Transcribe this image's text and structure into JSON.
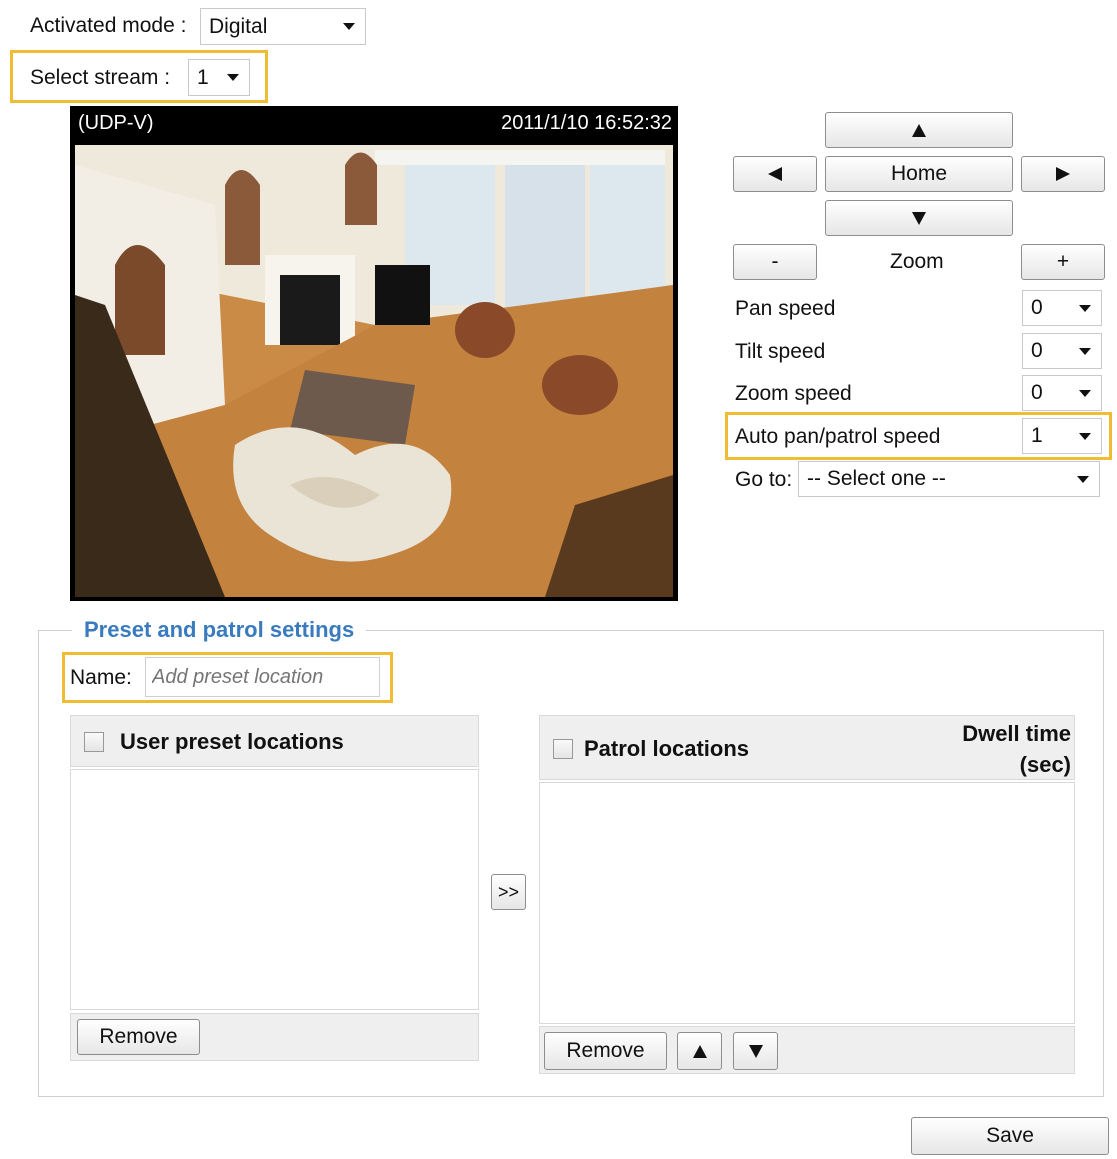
{
  "activated_mode": {
    "label": "Activated mode :",
    "value": "Digital"
  },
  "select_stream": {
    "label": "Select stream :",
    "value": "1"
  },
  "video": {
    "protocol": "(UDP-V)",
    "timestamp": "2011/1/10 16:52:32"
  },
  "ptz": {
    "home_label": "Home",
    "zoom_label": "Zoom",
    "zoom_out_label": "-",
    "zoom_in_label": "+",
    "pan_speed": {
      "label": "Pan speed",
      "value": "0"
    },
    "tilt_speed": {
      "label": "Tilt speed",
      "value": "0"
    },
    "zoom_speed": {
      "label": "Zoom speed",
      "value": "0"
    },
    "auto_pan_speed": {
      "label": "Auto pan/patrol speed",
      "value": "1"
    },
    "goto": {
      "label": "Go to:",
      "value": "-- Select one --"
    }
  },
  "preset": {
    "legend": "Preset and patrol settings",
    "name_label": "Name:",
    "name_placeholder": "Add preset location",
    "user_presets_header": "User preset locations",
    "patrol_header": "Patrol locations",
    "dwell_line1": "Dwell time",
    "dwell_line2": "(sec)",
    "move_label": ">>",
    "remove_label": "Remove"
  },
  "save_label": "Save",
  "colors": {
    "highlight": "#f0bc34",
    "legend": "#3a7bbf"
  }
}
